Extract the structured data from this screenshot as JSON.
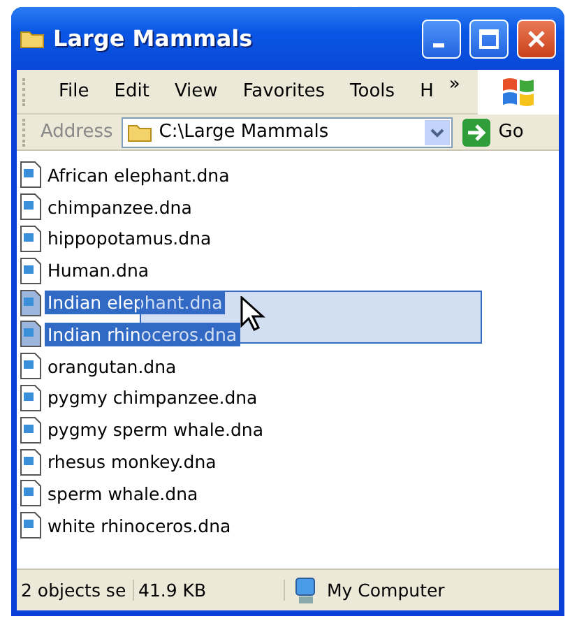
{
  "window": {
    "title": "Large Mammals"
  },
  "menu": [
    "File",
    "Edit",
    "View",
    "Favorites",
    "Tools",
    "H"
  ],
  "menu_overflow": "»",
  "address": {
    "label": "Address",
    "value": "C:\\Large Mammals",
    "go": "Go"
  },
  "files": [
    {
      "name": "African elephant.dna",
      "selected": false
    },
    {
      "name": "chimpanzee.dna",
      "selected": false
    },
    {
      "name": "hippopotamus.dna",
      "selected": false
    },
    {
      "name": "Human.dna",
      "selected": false
    },
    {
      "name": "Indian elephant.dna",
      "selected": true
    },
    {
      "name": "Indian rhinoceros.dna",
      "selected": true
    },
    {
      "name": "orangutan.dna",
      "selected": false
    },
    {
      "name": "pygmy chimpanzee.dna",
      "selected": false
    },
    {
      "name": "pygmy sperm whale.dna",
      "selected": false
    },
    {
      "name": "rhesus monkey.dna",
      "selected": false
    },
    {
      "name": "sperm whale.dna",
      "selected": false
    },
    {
      "name": "white rhinoceros.dna",
      "selected": false
    }
  ],
  "status_bar": {
    "selection": "2 objects se",
    "size": "41.9 KB",
    "location": "My Computer"
  }
}
